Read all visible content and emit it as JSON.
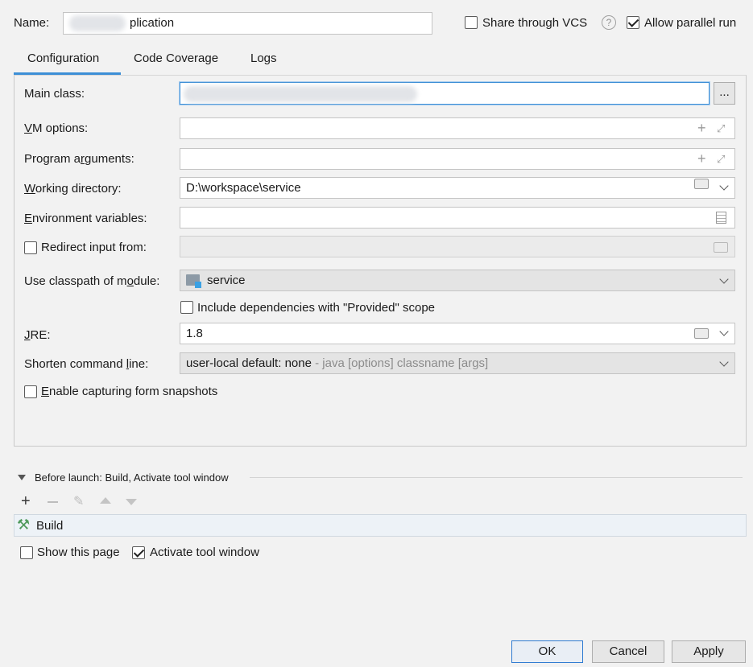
{
  "header": {
    "name_label": "Name:",
    "name_value": "plication",
    "share_vcs_label": "Share through VCS",
    "share_vcs_checked": false,
    "help_icon": "question-circle-icon",
    "allow_parallel_label": "Allow parallel run",
    "allow_parallel_checked": true
  },
  "tabs": {
    "configuration": "Configuration",
    "code_coverage": "Code Coverage",
    "logs": "Logs",
    "active": "Configuration"
  },
  "form": {
    "main_class_label": "Main class:",
    "main_class_browse": "...",
    "vm_options_label": "VM options:",
    "vm_options_value": "",
    "program_args_label": "Program arguments:",
    "program_args_value": "",
    "working_dir_label": "Working directory:",
    "working_dir_value": "D:\\workspace\\service",
    "env_vars_label": "Environment variables:",
    "env_vars_value": "",
    "redirect_input_label": "Redirect input from:",
    "redirect_input_checked": false,
    "classpath_label": "Use classpath of module:",
    "classpath_value": "service",
    "include_deps_label": "Include dependencies with \"Provided\" scope",
    "include_deps_checked": false,
    "jre_label": "JRE:",
    "jre_value": "1.8",
    "shorten_label": "Shorten command line:",
    "shorten_value": "user-local default: none",
    "shorten_hint": "- java [options] classname [args]",
    "snapshots_label": "Enable capturing form snapshots",
    "snapshots_checked": false
  },
  "before_launch": {
    "title": "Before launch: Build, Activate tool window",
    "tasks": [
      "Build"
    ],
    "show_page_label": "Show this page",
    "show_page_checked": false,
    "activate_label": "Activate tool window",
    "activate_checked": true
  },
  "footer": {
    "ok": "OK",
    "cancel": "Cancel",
    "apply": "Apply"
  },
  "colors": {
    "accent": "#3d8fd6",
    "background": "#f2f2f2",
    "build_icon": "#4f9a5c"
  }
}
